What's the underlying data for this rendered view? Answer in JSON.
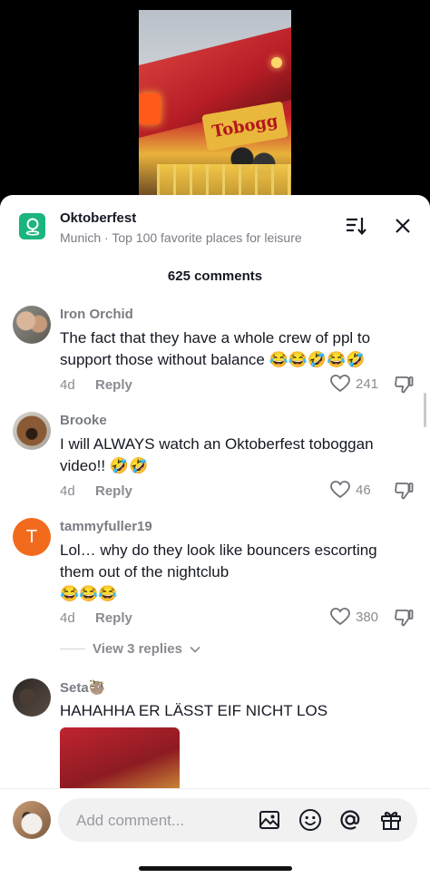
{
  "place": {
    "title": "Oktoberfest",
    "subtitle": "Munich · Top 100 favorite places for leisure"
  },
  "comments_count": "625 comments",
  "comments": [
    {
      "user": "Iron Orchid",
      "text_line1": "The fact that they have a whole crew of ppl to",
      "text_line2": "support those without balance 😂😂🤣😂🤣",
      "age": "4d",
      "reply": "Reply",
      "likes": "241"
    },
    {
      "user": "Brooke",
      "text_line1": "I will ALWAYS watch an Oktoberfest toboggan",
      "text_line2": "video!! 🤣🤣",
      "age": "4d",
      "reply": "Reply",
      "likes": "46"
    },
    {
      "user": "tammyfuller19",
      "avatar_letter": "T",
      "text_line1": "Lol… why do they look like bouncers escorting",
      "text_line2": "them out of the nightclub",
      "text_line3": "😂😂😂",
      "age": "4d",
      "reply": "Reply",
      "likes": "380",
      "view_replies": "View 3 replies"
    },
    {
      "user": "Seta🦥",
      "text_line1": "HAHAHHA ER LÄSST EIF NICHT LOS"
    }
  ],
  "input": {
    "placeholder": "Add comment..."
  },
  "colors": {
    "accent_place": "#1bb57e",
    "avatar_t": "#f26b1d"
  }
}
